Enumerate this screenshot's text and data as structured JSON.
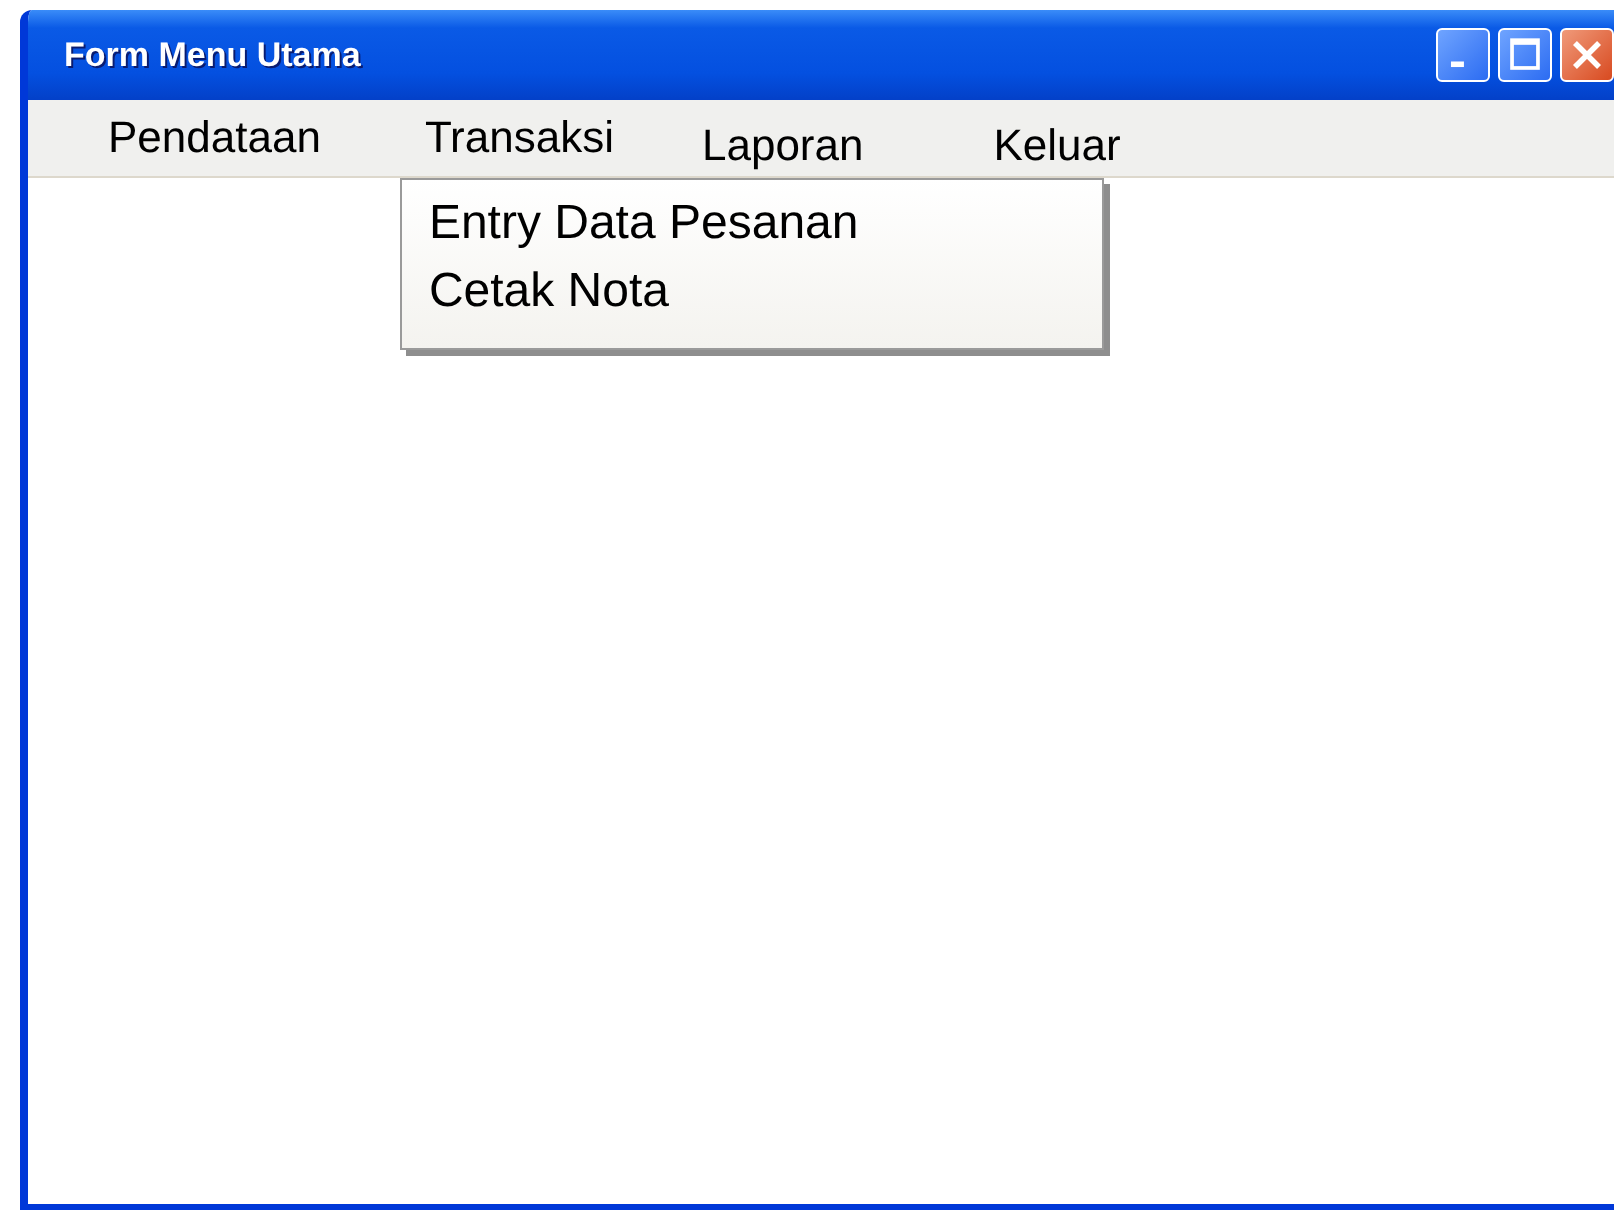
{
  "window": {
    "title": "Form Menu Utama"
  },
  "menu": [
    {
      "label": "Pendataan"
    },
    {
      "label": "Transaksi",
      "submenu": [
        {
          "label": "Entry Data Pesanan"
        },
        {
          "label": "Cetak Nota"
        }
      ]
    },
    {
      "label": "Laporan"
    },
    {
      "label": "Keluar"
    }
  ]
}
